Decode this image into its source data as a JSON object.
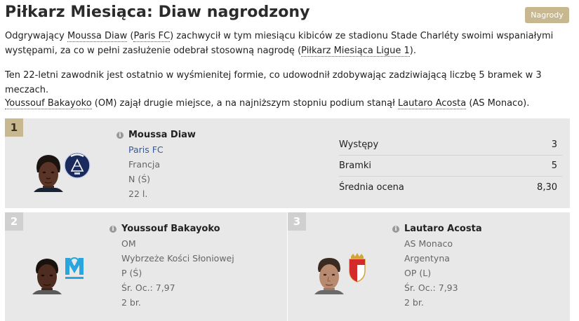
{
  "header": {
    "title": "Piłkarz Miesiąca: Diaw nagrodzony",
    "tag_label": "Nagrody"
  },
  "article": {
    "p1_a": "Odgrywający ",
    "p1_player": "Moussa Diaw",
    "p1_b": " (",
    "p1_club": "Paris FC",
    "p1_c": ") zachwycił w tym miesiącu kibiców ze stadionu Stade Charléty swoimi wspaniałymi występami, za co w pełni zasłużenie odebrał stosowną nagrodę (",
    "p1_award": "Piłkarz Miesiąca Ligue 1",
    "p1_d": ").",
    "p2": "Ten 22-letni zawodnik jest ostatnio w wyśmienitej formie, co udowodnił zdobywając zadziwiającą liczbę 5 bramek w 3 meczach.",
    "p3_player2": "Youssouf Bakayoko",
    "p3_a": " (OM) zajął drugie miejsce, a na najniższym stopniu podium stanął ",
    "p3_player3": "Lautaro Acosta",
    "p3_b": " (AS Monaco)."
  },
  "winner": {
    "rank": "1",
    "info_icon": "i",
    "name": "Moussa Diaw",
    "club": "Paris FC",
    "nation": "Francja",
    "position": "N (Ś)",
    "age": "22 l.",
    "stats": [
      {
        "label": "Występy",
        "value": "3"
      },
      {
        "label": "Bramki",
        "value": "5"
      },
      {
        "label": "Średnia ocena",
        "value": "8,30"
      }
    ]
  },
  "second": {
    "rank": "2",
    "info_icon": "i",
    "name": "Youssouf Bakayoko",
    "club": "OM",
    "nation": "Wybrzeże Kości Słoniowej",
    "position": "P (Ś)",
    "rating": "Śr. Oc.: 7,97",
    "goals": "2 br."
  },
  "third": {
    "rank": "3",
    "info_icon": "i",
    "name": "Lautaro Acosta",
    "club": "AS Monaco",
    "nation": "Argentyna",
    "position": "OP (L)",
    "rating": "Śr. Oc.: 7,93",
    "goals": "2 br."
  },
  "icons": {
    "info": "info-icon",
    "parisfc": "paris-fc-crest-icon",
    "om": "om-crest-icon",
    "monaco": "as-monaco-crest-icon"
  },
  "colors": {
    "gold": "#c8b890",
    "card_bg": "#e8e8e8",
    "link": "#2f5a9e"
  }
}
